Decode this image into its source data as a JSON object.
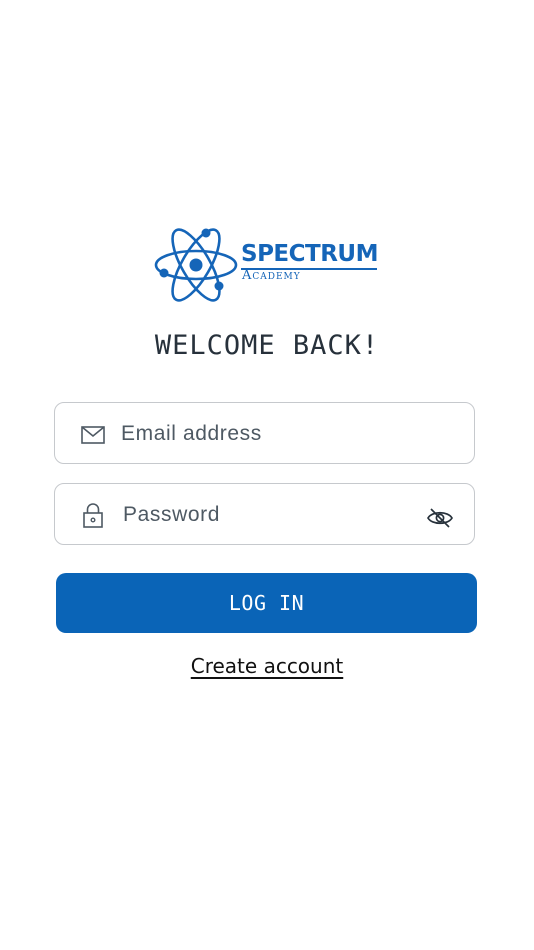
{
  "logo": {
    "name": "SPECTRUM",
    "subtitle": "Academy",
    "brand_color": "#1565b8",
    "icon": "atom-icon"
  },
  "welcome_title": "WELCOME BACK!",
  "email_field": {
    "placeholder": "Email address",
    "value": "",
    "icon": "mail-icon"
  },
  "password_field": {
    "placeholder": "Password",
    "value": "",
    "icon": "lock-icon",
    "toggle_icon": "eye-off-icon"
  },
  "login_button": {
    "label": "LOG IN",
    "color": "#0a64b7"
  },
  "create_account_link": "Create account"
}
